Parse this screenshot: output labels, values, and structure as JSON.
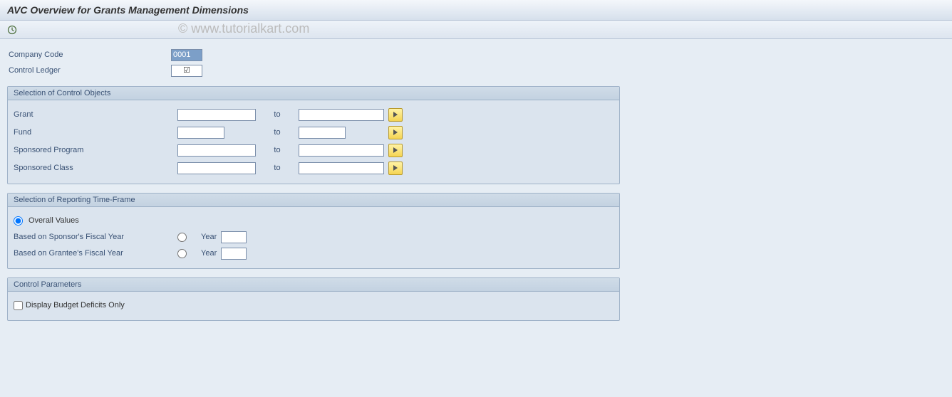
{
  "watermark": "© www.tutorialkart.com",
  "header": {
    "title": "AVC Overview for Grants Management Dimensions"
  },
  "top_fields": {
    "company_code_label": "Company Code",
    "company_code_value": "0001",
    "control_ledger_label": "Control Ledger",
    "control_ledger_checked_glyph": "☑"
  },
  "group_control_objects": {
    "title": "Selection of Control Objects",
    "to_label": "to",
    "rows": [
      {
        "label": "Grant",
        "from": "",
        "to": ""
      },
      {
        "label": "Fund",
        "from": "",
        "to": ""
      },
      {
        "label": "Sponsored Program",
        "from": "",
        "to": ""
      },
      {
        "label": "Sponsored Class",
        "from": "",
        "to": ""
      }
    ]
  },
  "group_timeframe": {
    "title": "Selection of  Reporting Time-Frame",
    "overall_label": "Overall Values",
    "sponsor_label": "Based on Sponsor's Fiscal Year",
    "grantee_label": "Based on Grantee's Fiscal Year",
    "year_label": "Year",
    "sponsor_year_value": "",
    "grantee_year_value": ""
  },
  "group_control_params": {
    "title": "Control Parameters",
    "deficits_label": "Display Budget Deficits Only"
  }
}
